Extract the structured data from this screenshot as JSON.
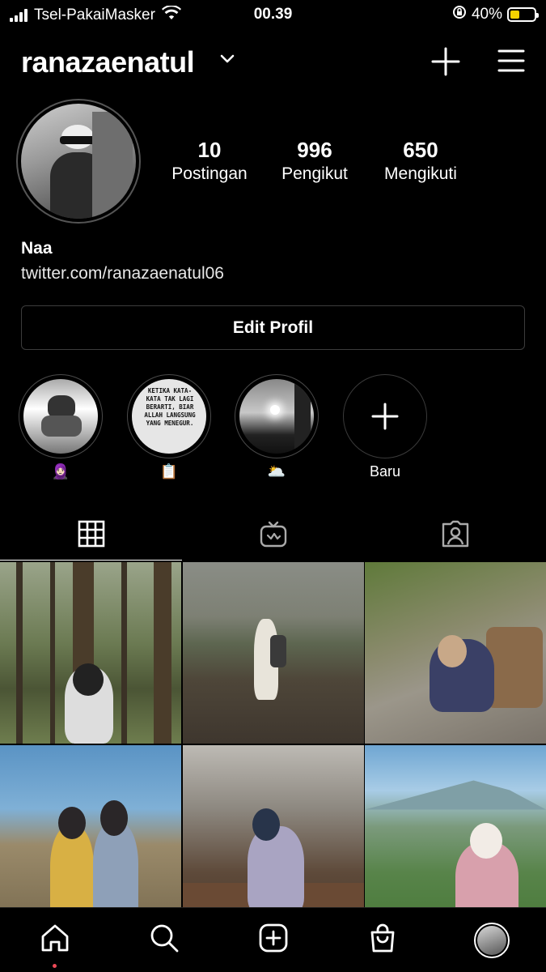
{
  "status_bar": {
    "carrier": "Tsel-PakaiMasker",
    "time": "00.39",
    "battery_percent": "40%",
    "battery_level": 0.4,
    "battery_color": "#f5d300"
  },
  "header": {
    "username": "ranazaenatul",
    "icons": [
      "chevron-down-icon",
      "new-post-plus-icon",
      "menu-icon"
    ]
  },
  "profile": {
    "stats": [
      {
        "value": "10",
        "label": "Postingan"
      },
      {
        "value": "996",
        "label": "Pengikut"
      },
      {
        "value": "650",
        "label": "Mengikuti"
      }
    ],
    "name": "Naa",
    "link": "twitter.com/ranazaenatul06",
    "edit_button": "Edit Profil"
  },
  "highlights": [
    {
      "label": "🧕🏻"
    },
    {
      "label": "📋"
    },
    {
      "label": "🌥️"
    },
    {
      "label": "Baru"
    }
  ],
  "highlight_quote": "KETIKA KATA-KATA TAK LAGI BERARTI, BIAR ALLAH LANGSUNG YANG MENEGUR.",
  "tabs": [
    "grid-icon",
    "igtv-icon",
    "tagged-icon"
  ],
  "bottom_nav": [
    "home-icon",
    "search-icon",
    "create-icon",
    "shop-icon",
    "profile-avatar"
  ],
  "accent_colors": {
    "notification_dot": "#ed4956",
    "border": "#3c3c3c"
  }
}
